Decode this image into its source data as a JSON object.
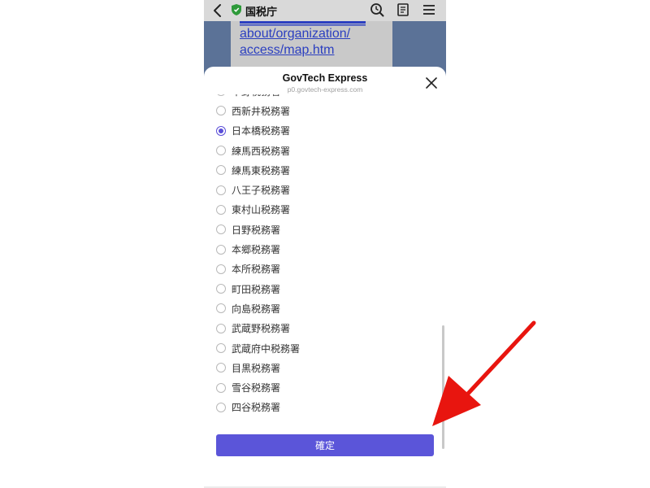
{
  "navbar": {
    "title": "国税庁",
    "icons": [
      "back-chevron-icon",
      "shield-icon",
      "history-icon",
      "reader-icon",
      "menu-icon"
    ]
  },
  "background_page": {
    "link_lines": [
      "about/organization/",
      "access/map.htm"
    ]
  },
  "sheet": {
    "title": "GovTech Express",
    "subtitle": "p0.govtech-express.com",
    "options": [
      {
        "label": "中野税務署",
        "selected": false
      },
      {
        "label": "西新井税務署",
        "selected": false
      },
      {
        "label": "日本橋税務署",
        "selected": true
      },
      {
        "label": "練馬西税務署",
        "selected": false
      },
      {
        "label": "練馬東税務署",
        "selected": false
      },
      {
        "label": "八王子税務署",
        "selected": false
      },
      {
        "label": "東村山税務署",
        "selected": false
      },
      {
        "label": "日野税務署",
        "selected": false
      },
      {
        "label": "本郷税務署",
        "selected": false
      },
      {
        "label": "本所税務署",
        "selected": false
      },
      {
        "label": "町田税務署",
        "selected": false
      },
      {
        "label": "向島税務署",
        "selected": false
      },
      {
        "label": "武蔵野税務署",
        "selected": false
      },
      {
        "label": "武蔵府中税務署",
        "selected": false
      },
      {
        "label": "目黒税務署",
        "selected": false
      },
      {
        "label": "雪谷税務署",
        "selected": false
      },
      {
        "label": "四谷税務署",
        "selected": false
      }
    ],
    "confirm_label": "確定"
  },
  "colors": {
    "accent": "#5b55d9",
    "annotation_arrow": "#e8150f"
  }
}
